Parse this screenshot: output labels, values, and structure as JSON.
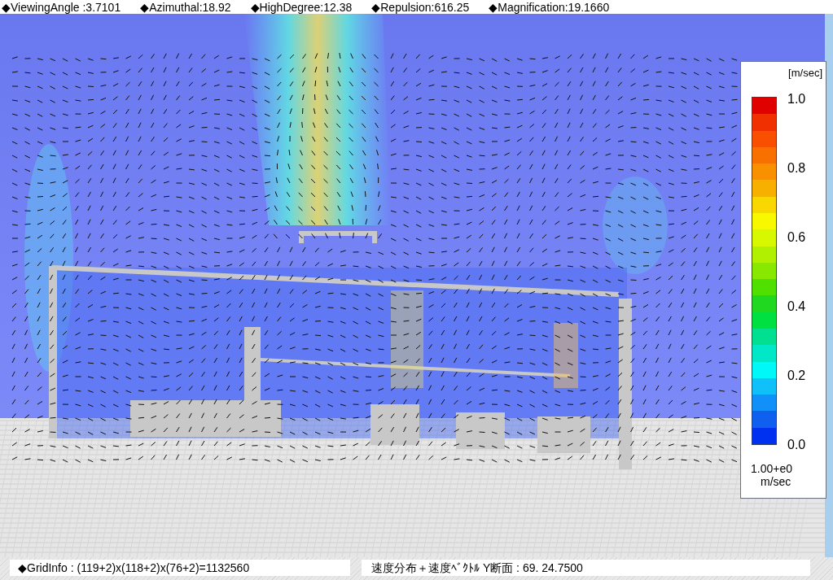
{
  "header": {
    "items": [
      "◆ViewingAngle :3.7101",
      "◆Azimuthal:18.92",
      "◆HighDegree:12.38",
      "◆Repulsion:616.25",
      "◆Magnification:19.1660"
    ]
  },
  "legend": {
    "unit": "[m/sec]",
    "ticks": [
      "1.0",
      "0.8",
      "0.6",
      "0.4",
      "0.2",
      "0.0"
    ],
    "scale": "1.00+e0",
    "scale_unit": "m/sec"
  },
  "status_bar": {
    "grid_info": "◆GridInfo : (119+2)x(118+2)x(76+2)=1132560",
    "section": "速度分布＋速度ﾍﾞｸﾄﾙ Y断面 : 69.  24.7500"
  }
}
